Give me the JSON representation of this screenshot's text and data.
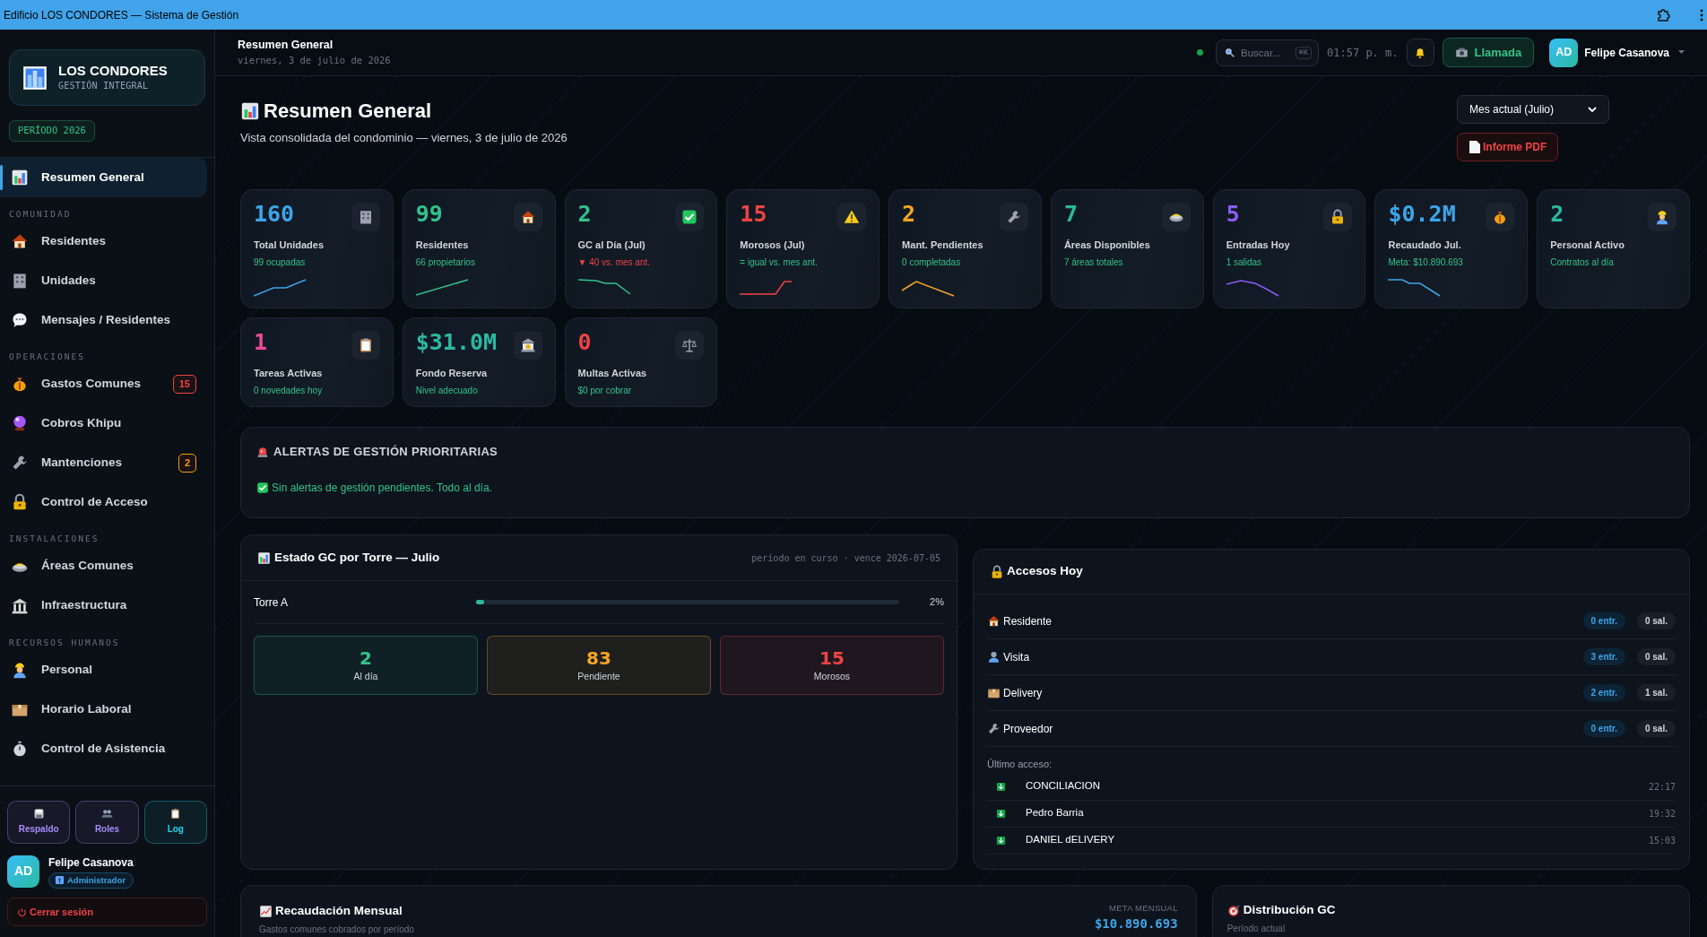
{
  "window": {
    "title": "Edificio LOS CONDORES — Sistema de Gestión"
  },
  "sidebar": {
    "brand": {
      "title": "LOS CONDORES",
      "subtitle": "GESTIÓN INTEGRAL"
    },
    "period": "PERÍODO 2026",
    "sections": [
      {
        "items": [
          {
            "label": "Resumen General",
            "selected": true
          }
        ]
      },
      {
        "label": "COMUNIDAD",
        "items": [
          {
            "label": "Residentes",
            "selected": false
          },
          {
            "label": "Unidades",
            "selected": false
          },
          {
            "label": "Mensajes / Residentes",
            "selected": false
          }
        ]
      },
      {
        "label": "OPERACIONES",
        "items": [
          {
            "label": "Gastos Comunes",
            "selected": false,
            "badge": {
              "text": "15",
              "color": "#ef4444"
            }
          },
          {
            "label": "Cobros Khipu",
            "selected": false
          },
          {
            "label": "Mantenciones",
            "selected": false,
            "badge": {
              "text": "2",
              "color": "#f59e0b"
            }
          },
          {
            "label": "Control de Acceso",
            "selected": false
          }
        ]
      },
      {
        "label": "INSTALACIONES",
        "items": [
          {
            "label": "Áreas Comunes",
            "selected": false
          },
          {
            "label": "Infraestructura",
            "selected": false
          }
        ]
      },
      {
        "label": "RECURSOS HUMANOS",
        "items": [
          {
            "label": "Personal",
            "selected": false
          },
          {
            "label": "Horario Laboral",
            "selected": false
          },
          {
            "label": "Control de Asistencia",
            "selected": false
          }
        ]
      }
    ],
    "tools": [
      {
        "label": "Respaldo",
        "color": "#a78bfa"
      },
      {
        "label": "Roles",
        "color": "#a78bfa"
      },
      {
        "label": "Log",
        "color": "#22d3ee"
      }
    ],
    "user": {
      "initials": "AD",
      "name": "Felipe Casanova",
      "role": "Administrador"
    },
    "logout": "Cerrar sesión"
  },
  "header": {
    "title": "Resumen General",
    "date": "viernes, 3 de julio de 2026",
    "search": {
      "placeholder": "Buscar...",
      "shortcut": "⌘K"
    },
    "time": "01:57 p. m.",
    "call_button": "Llamada",
    "user": {
      "initials": "AD",
      "name": "Felipe Casanova"
    }
  },
  "page": {
    "title": "Resumen General",
    "subtitle": "Vista consolidada del condominio — viernes, 3 de julio de 2026",
    "period_select": "Mes actual (Julio)",
    "pdf_button": "Informe PDF"
  },
  "kpis": [
    {
      "value": "160",
      "label": "Total Unidades",
      "note": "99 ocupadas",
      "color": "#3ea5e8",
      "negative": false
    },
    {
      "value": "99",
      "label": "Residentes",
      "note": "66 propietarios",
      "color": "#34c28a",
      "negative": false
    },
    {
      "value": "2",
      "label": "GC al Día (Jul)",
      "note": "▼ 40 vs. mes ant.",
      "color": "#34c28a",
      "negative": true
    },
    {
      "value": "15",
      "label": "Morosos (Jul)",
      "note": "= igual vs. mes ant.",
      "color": "#ef4444",
      "negative": false
    },
    {
      "value": "2",
      "label": "Mant. Pendientes",
      "note": "0 completadas",
      "color": "#f5a524",
      "negative": false
    },
    {
      "value": "7",
      "label": "Áreas Disponibles",
      "note": "7 áreas totales",
      "color": "#2bb9a0",
      "negative": false
    },
    {
      "value": "5",
      "label": "Entradas Hoy",
      "note": "1 salidas",
      "color": "#8b5cf6",
      "negative": false
    },
    {
      "value": "$0.2M",
      "label": "Recaudado Jul.",
      "note": "Meta: $10.890.693",
      "color": "#3ea5e8",
      "negative": false
    },
    {
      "value": "2",
      "label": "Personal Activo",
      "note": "Contratos al día",
      "color": "#2bb9a0",
      "negative": false
    },
    {
      "value": "1",
      "label": "Tareas Activas",
      "note": "0 novedades hoy",
      "color": "#ec4899",
      "negative": false
    },
    {
      "value": "$31.0M",
      "label": "Fondo Reserva",
      "note": "Nivel adecuado",
      "color": "#2bb9a0",
      "negative": false
    },
    {
      "value": "0",
      "label": "Multas Activas",
      "note": "$0 por cobrar",
      "color": "#ef4444",
      "negative": false
    }
  ],
  "alerts": {
    "title": "ALERTAS DE GESTIÓN PRIORITARIAS",
    "message": "Sin alertas de gestión pendientes. Todo al día."
  },
  "tower_status": {
    "title": "Estado GC por Torre — Julio",
    "meta": "período en curso · vence 2026-07-05",
    "towers": [
      {
        "name": "Torre A",
        "level": 0.02,
        "percent": "2%"
      }
    ],
    "stats": [
      {
        "value": "2",
        "label": "Al día",
        "color": "#34c28a"
      },
      {
        "value": "83",
        "label": "Pendiente",
        "color": "#f5a524"
      },
      {
        "value": "15",
        "label": "Morosos",
        "color": "#ef4444"
      }
    ]
  },
  "access": {
    "title": "Accesos Hoy",
    "types": [
      {
        "label": "Residente",
        "entries": "0 entr.",
        "exits": "0 sal."
      },
      {
        "label": "Visita",
        "entries": "3 entr.",
        "exits": "0 sal."
      },
      {
        "label": "Delivery",
        "entries": "2 entr.",
        "exits": "1 sal."
      },
      {
        "label": "Proveedor",
        "entries": "0 entr.",
        "exits": "0 sal."
      }
    ],
    "last_label": "Último acceso:",
    "last": [
      {
        "name": "CONCILIACION",
        "time": "22:17"
      },
      {
        "name": "Pedro Barria",
        "time": "19:32"
      },
      {
        "name": "DANIEL dELIVERY",
        "time": "15:03"
      }
    ]
  },
  "collection": {
    "title": "Recaudación Mensual",
    "subtitle": "Gastos comunes cobrados por período",
    "goal_label": "META MENSUAL",
    "goal": "$10.890.693"
  },
  "distribution": {
    "title": "Distribución GC",
    "subtitle": "Período actual"
  }
}
